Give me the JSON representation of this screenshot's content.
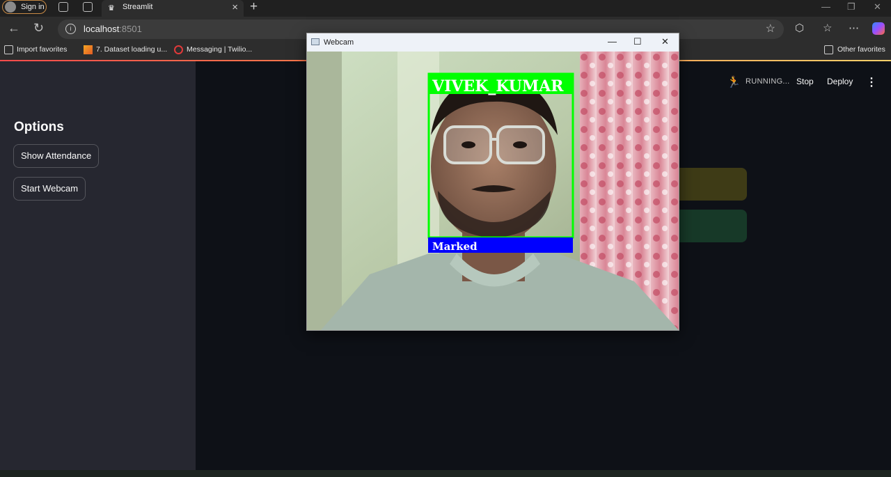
{
  "browser": {
    "profile_label": "Sign in",
    "active_tab": {
      "title": "Streamlit"
    },
    "url": {
      "host": "localhost",
      "port": ":8501"
    },
    "favorites": [
      {
        "label": "Import favorites"
      },
      {
        "label": "7. Dataset loading u..."
      },
      {
        "label": "Messaging | Twilio..."
      }
    ],
    "other_favorites": "Other favorites"
  },
  "app": {
    "sidebar": {
      "title": "Options",
      "buttons": [
        {
          "label": "Show Attendance"
        },
        {
          "label": "Start Webcam"
        }
      ]
    },
    "toolbar": {
      "status": "RUNNING...",
      "stop_label": "Stop",
      "deploy_label": "Deploy"
    },
    "colors": {
      "accent": "#ff4b4b",
      "sidebar_bg": "#262730",
      "main_bg": "#0e1117",
      "alert_warning": "#3e3b16",
      "alert_success": "#173928"
    }
  },
  "webcam_window": {
    "title": "Webcam",
    "detection": {
      "name_label": "VIVEK_KUMAR",
      "status_label": "Marked",
      "box_color": "#00ff00",
      "status_color": "#0000ff"
    }
  }
}
